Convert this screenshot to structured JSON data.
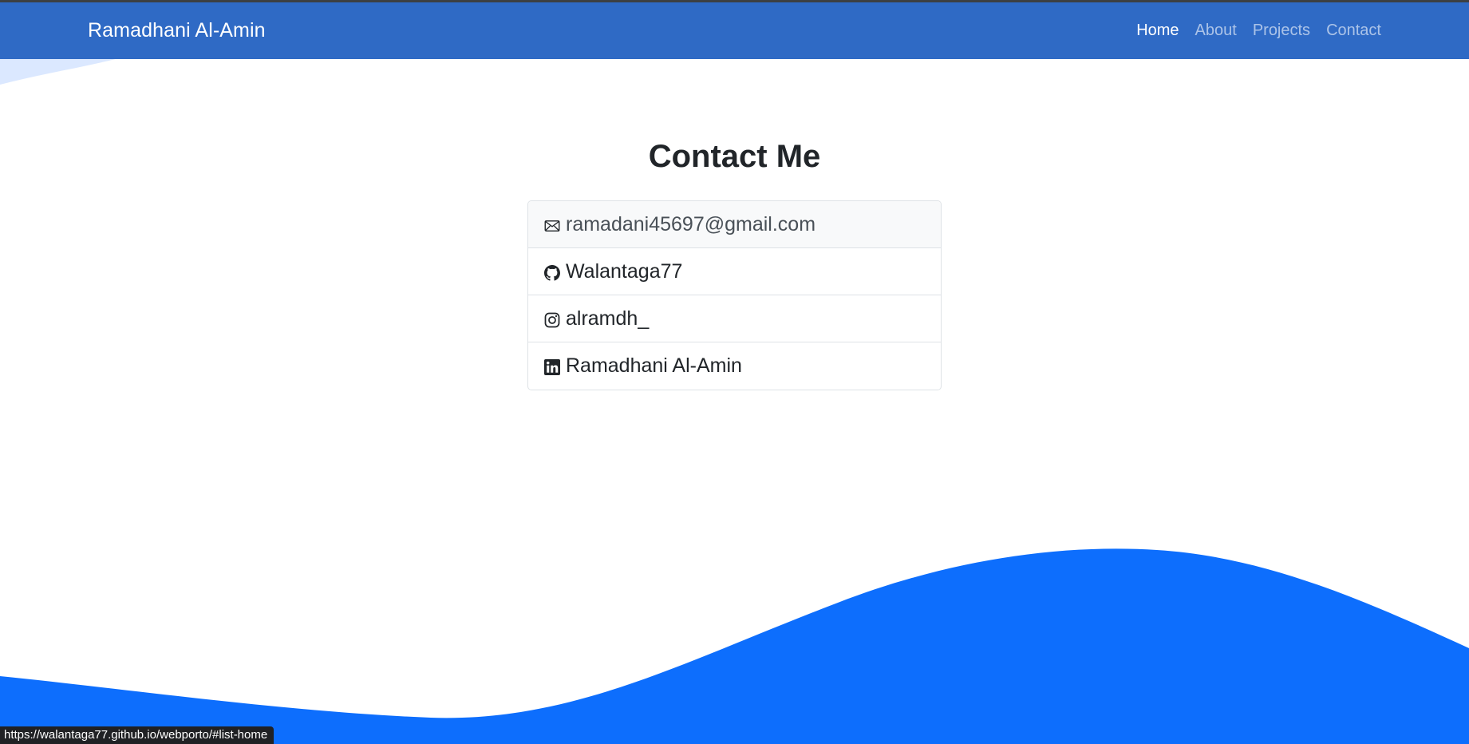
{
  "navbar": {
    "brand": "Ramadhani Al-Amin",
    "links": [
      {
        "label": "Home",
        "active": true
      },
      {
        "label": "About",
        "active": false
      },
      {
        "label": "Projects",
        "active": false
      },
      {
        "label": "Contact",
        "active": false
      }
    ]
  },
  "contact": {
    "title": "Contact Me",
    "items": [
      {
        "icon": "envelope-icon",
        "text": "ramadani45697@gmail.com"
      },
      {
        "icon": "github-icon",
        "text": "Walantaga77"
      },
      {
        "icon": "instagram-icon",
        "text": "alramdh_"
      },
      {
        "icon": "linkedin-icon",
        "text": "Ramadhani Al-Amin"
      }
    ]
  },
  "status_bar": {
    "url": "https://walantaga77.github.io/webporto/#list-home"
  },
  "colors": {
    "navbar": "#2f6ac5",
    "wave": "#0d6efd",
    "light_wave": "#dbe8ff",
    "text": "#212529"
  }
}
